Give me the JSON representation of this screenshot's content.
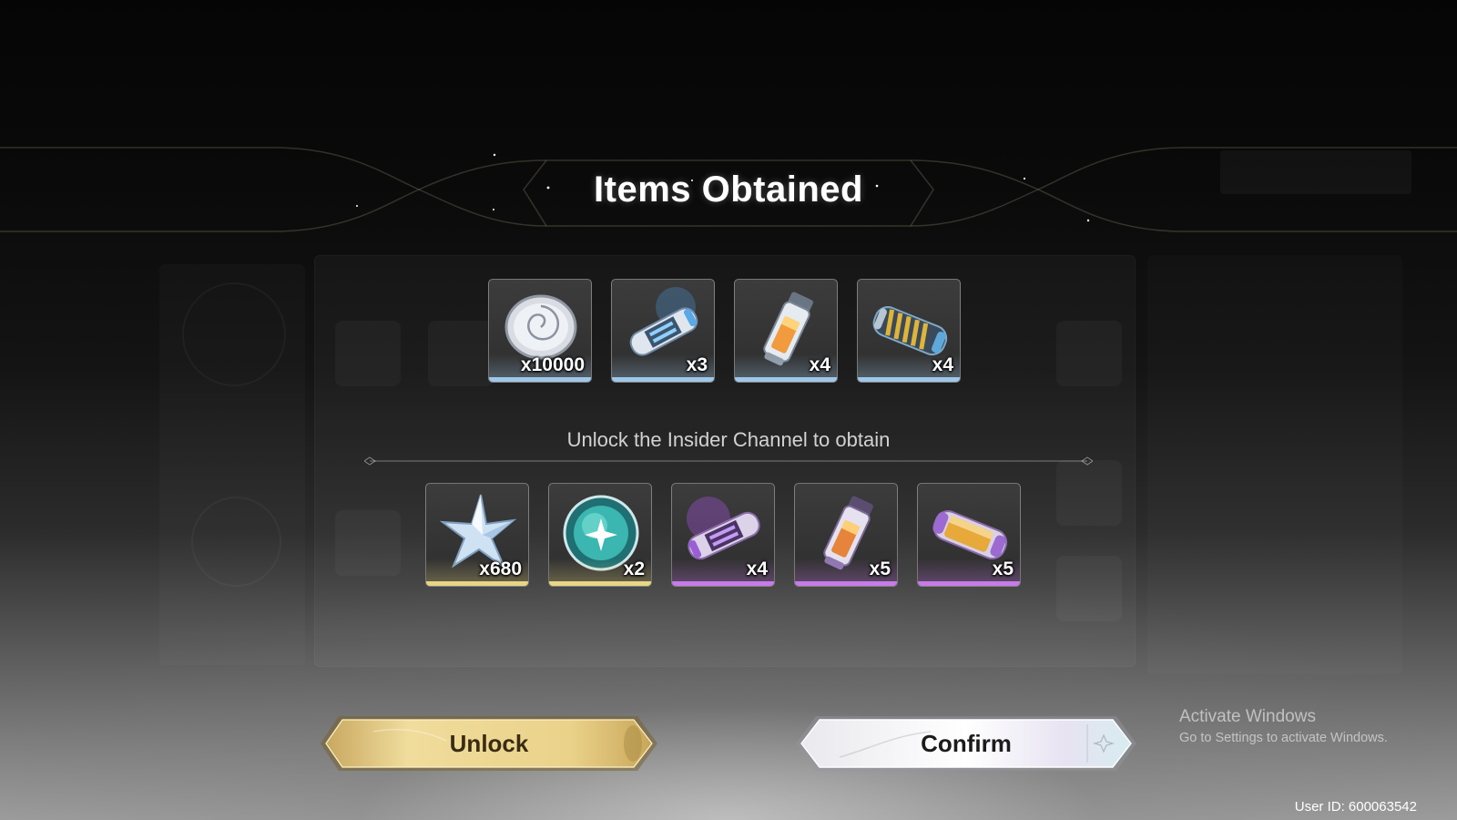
{
  "screen": {
    "title": "Items Obtained",
    "insider_prompt": "Unlock the Insider Channel to obtain"
  },
  "obtained_items": [
    {
      "icon": "silver-shell-coin-icon",
      "quantity": "x10000",
      "rarity_color": "#9fc7e8"
    },
    {
      "icon": "blue-energy-core-icon",
      "quantity": "x3",
      "rarity_color": "#9fc7e8"
    },
    {
      "icon": "orange-vial-icon",
      "quantity": "x4",
      "rarity_color": "#9fc7e8"
    },
    {
      "icon": "gold-coil-capsule-icon",
      "quantity": "x4",
      "rarity_color": "#9fc7e8"
    }
  ],
  "insider_items": [
    {
      "icon": "star-crystal-icon",
      "quantity": "x680",
      "rarity_color": "#e8d685"
    },
    {
      "icon": "teal-orb-icon",
      "quantity": "x2",
      "rarity_color": "#e8d685"
    },
    {
      "icon": "purple-energy-core-icon",
      "quantity": "x4",
      "rarity_color": "#c77be8"
    },
    {
      "icon": "purple-vial-icon",
      "quantity": "x5",
      "rarity_color": "#c77be8"
    },
    {
      "icon": "purple-gold-capsule-icon",
      "quantity": "x5",
      "rarity_color": "#c77be8"
    }
  ],
  "buttons": {
    "unlock_label": "Unlock",
    "confirm_label": "Confirm"
  },
  "watermark": {
    "line1": "Activate Windows",
    "line2": "Go to Settings to activate Windows."
  },
  "user_id": "User ID: 600063542"
}
